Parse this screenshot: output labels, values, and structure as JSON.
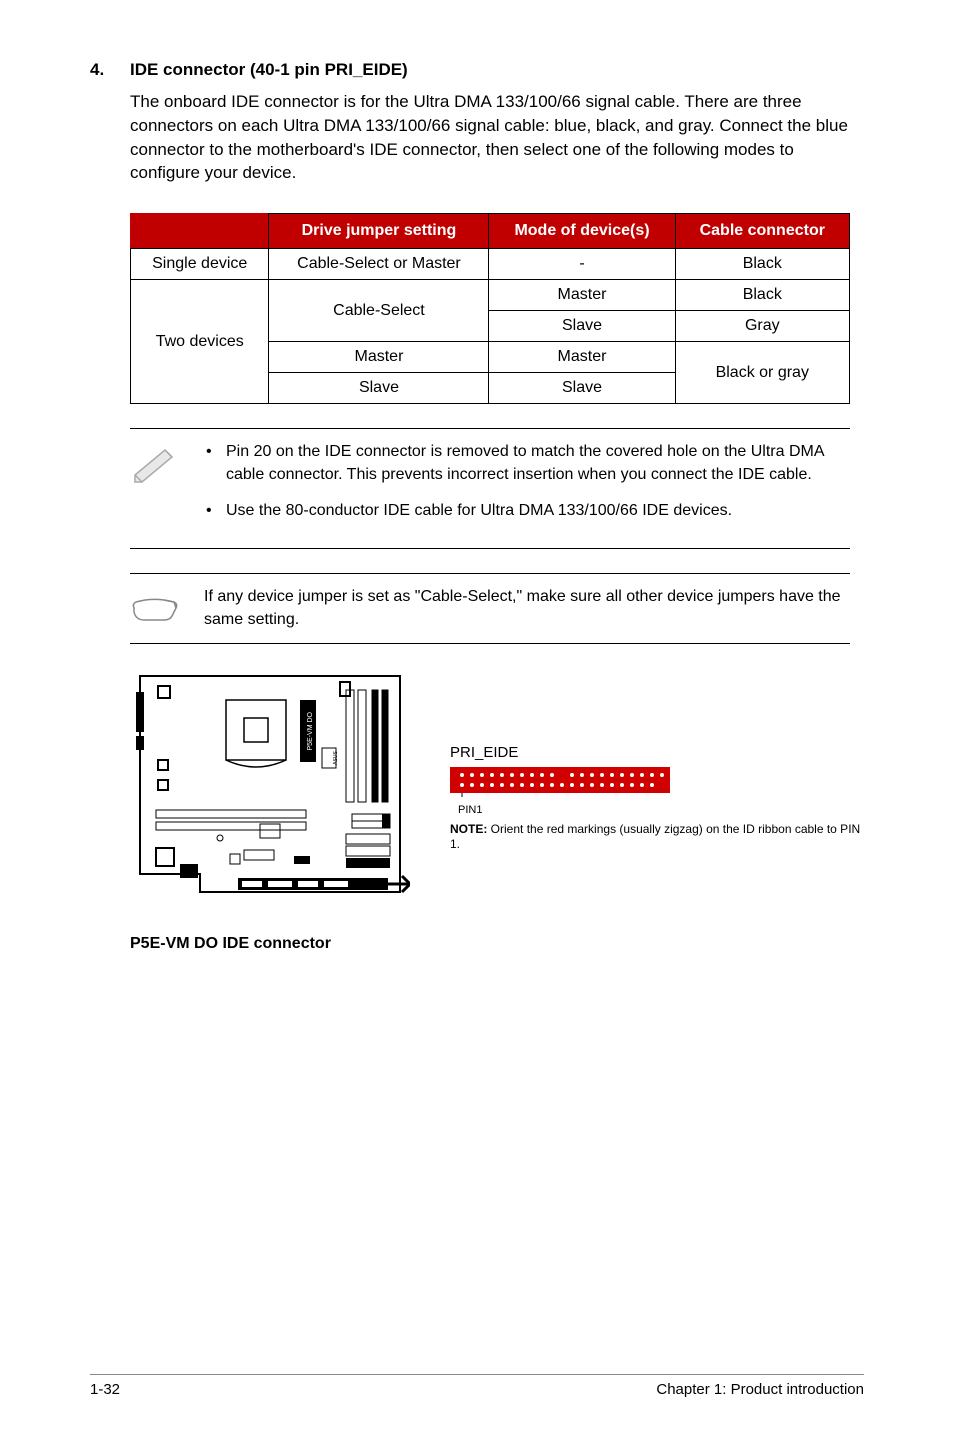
{
  "section": {
    "number": "4.",
    "title": "IDE connector (40-1 pin PRI_EIDE)",
    "body": "The onboard IDE connector is for the Ultra DMA 133/100/66 signal cable. There are three connectors on each Ultra DMA 133/100/66 signal cable: blue, black, and gray. Connect the blue connector to the motherboard's IDE connector, then select one of the following modes to configure your device."
  },
  "table": {
    "headers": [
      "",
      "Drive jumper setting",
      "Mode of device(s)",
      "Cable connector"
    ],
    "row1": {
      "c0": "Single device",
      "c1": "Cable-Select or Master",
      "c2": "-",
      "c3": "Black"
    },
    "two_devices_label": "Two devices",
    "cable_select_label": "Cable-Select",
    "master_label1": "Master",
    "black_label": "Black",
    "slave_label1": "Slave",
    "gray_label": "Gray",
    "master_label2": "Master",
    "master_label3": "Master",
    "slave_label2": "Slave",
    "slave_label3": "Slave",
    "black_or_gray": "Black or gray"
  },
  "notes": {
    "bullet1": "Pin 20 on the IDE connector is removed to match the covered hole on the Ultra DMA cable connector. This prevents incorrect insertion when you connect the IDE cable.",
    "bullet2": "Use the 80-conductor IDE cable for Ultra DMA 133/100/66 IDE devices.",
    "cable_select_note": "If any device jumper is set as \"Cable-Select,\" make sure all other device jumpers have the same setting."
  },
  "diagram": {
    "caption": "P5E-VM DO IDE connector",
    "chip_label": "P5E-VM DO",
    "conn_label": "PRI_EIDE",
    "pin1_label": "PIN1",
    "conn_note_bold": "NOTE:",
    "conn_note_text": " Orient the red markings (usually zigzag) on the ID ribbon cable to PIN 1."
  },
  "footer": {
    "left": "1-32",
    "right": "Chapter 1: Product introduction"
  }
}
